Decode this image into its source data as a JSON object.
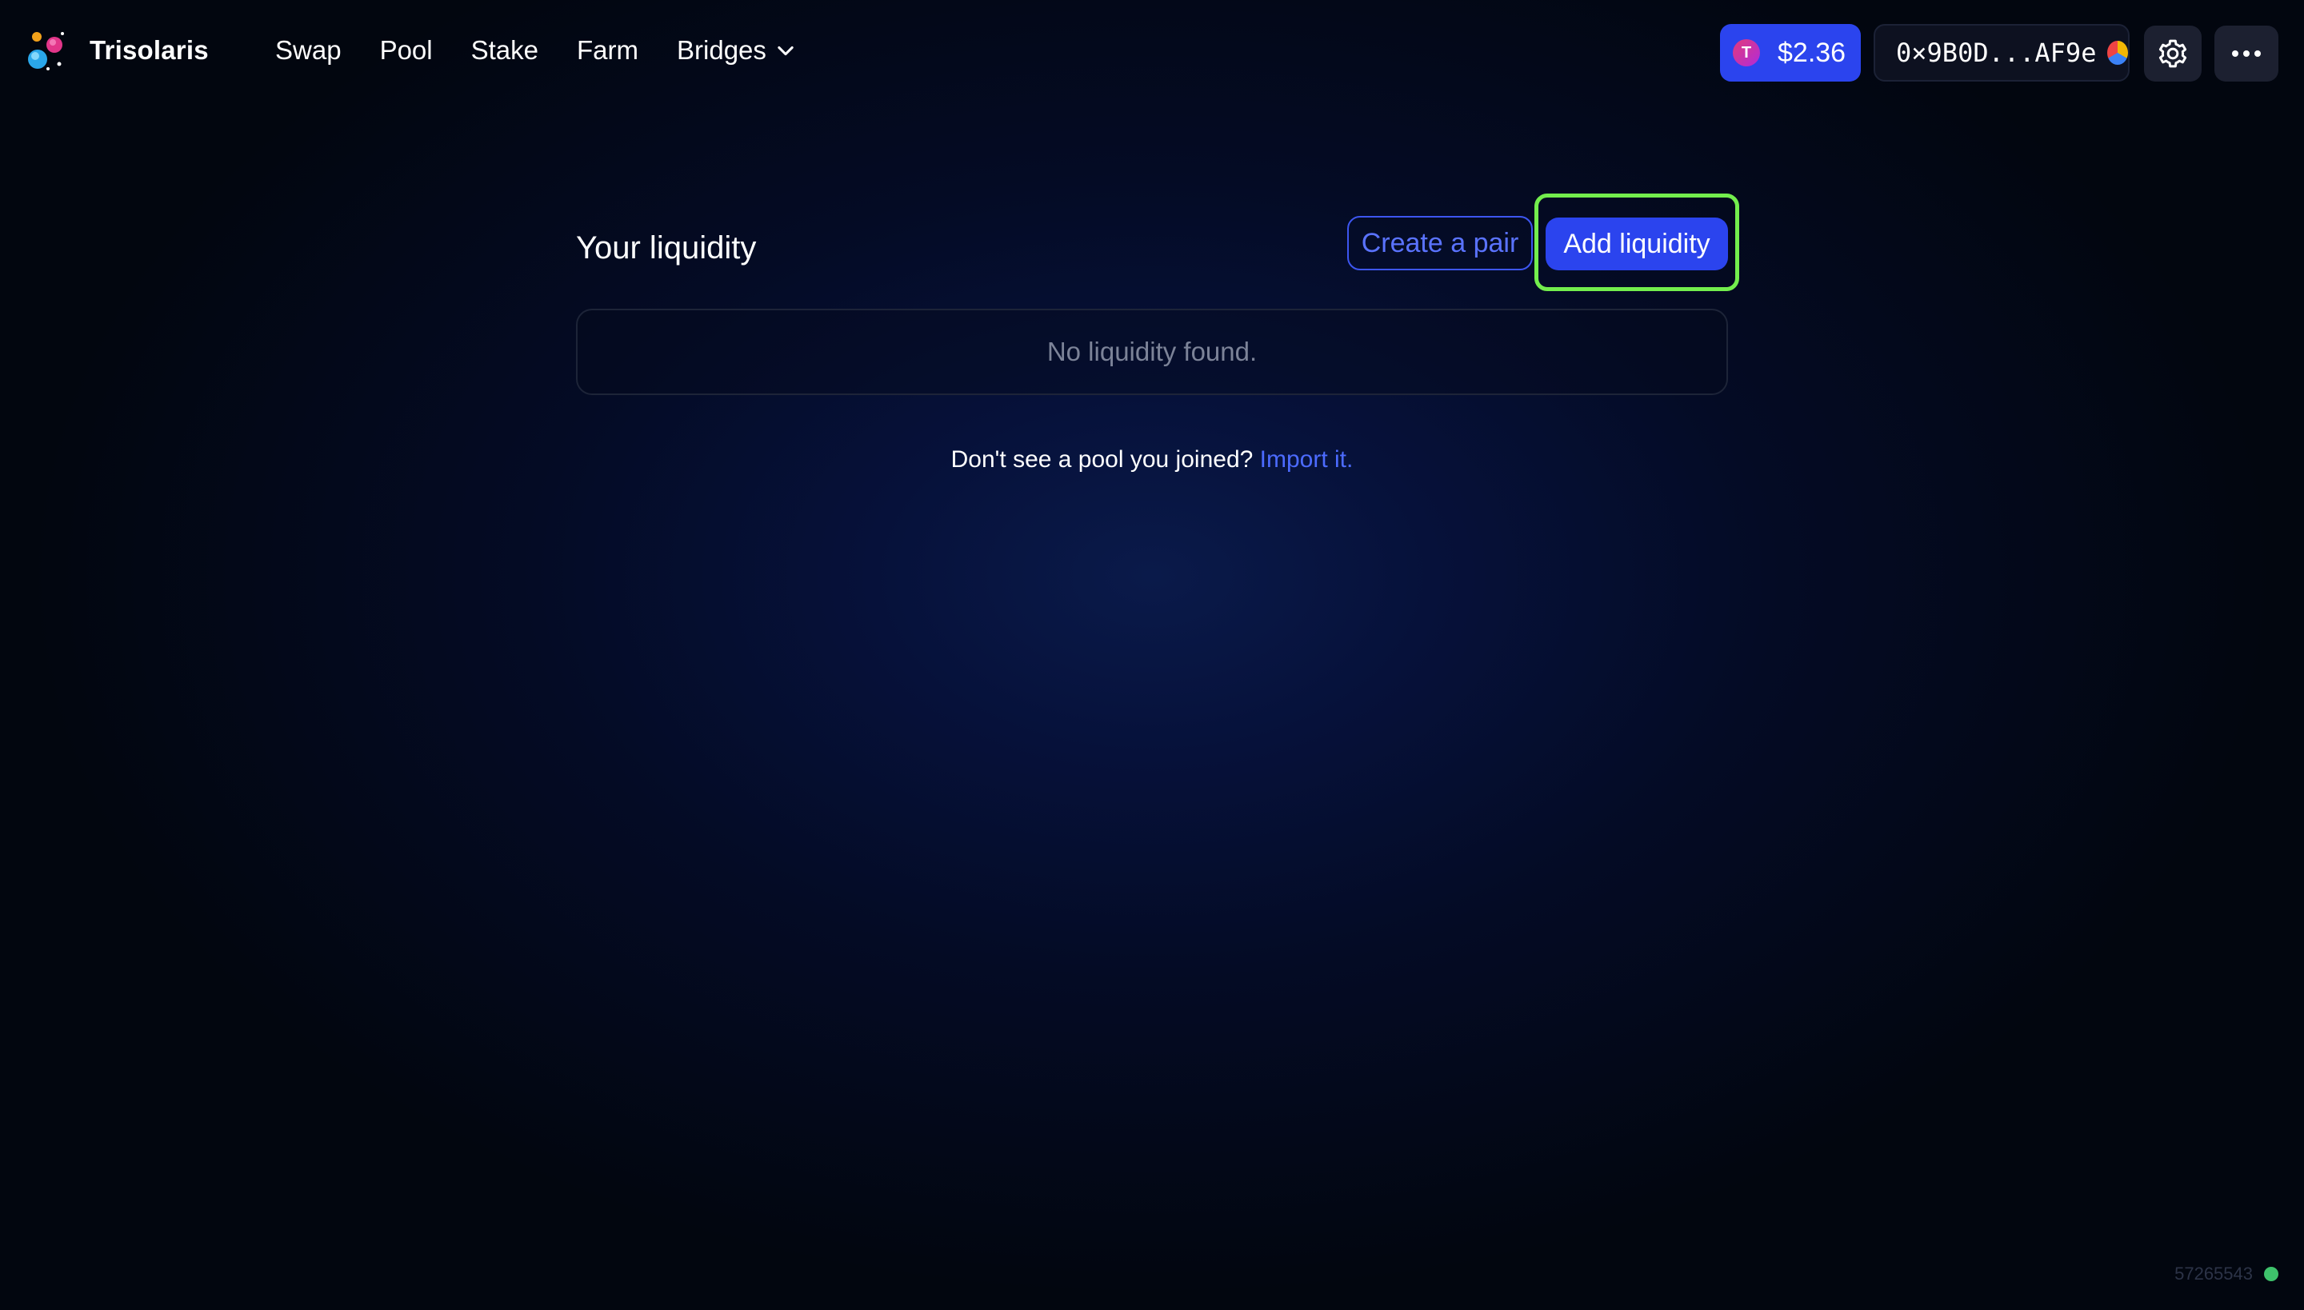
{
  "header": {
    "brand": "Trisolaris",
    "nav": {
      "swap": "Swap",
      "pool": "Pool",
      "stake": "Stake",
      "farm": "Farm",
      "bridges": "Bridges"
    },
    "token_price": "$2.36",
    "token_icon_letter": "T",
    "wallet_address": "0×9B0D...AF9e"
  },
  "main": {
    "title": "Your liquidity",
    "create_pair_label": "Create a pair",
    "add_liquidity_label": "Add liquidity",
    "empty_message": "No liquidity found.",
    "import_prompt": "Don't see a pool you joined?",
    "import_link": "Import it."
  },
  "footer": {
    "block_number": "57265543",
    "status_color": "#3ec26b"
  },
  "colors": {
    "accent": "#2b44ee",
    "highlight": "#73ee4d",
    "link": "#4c6bff"
  }
}
